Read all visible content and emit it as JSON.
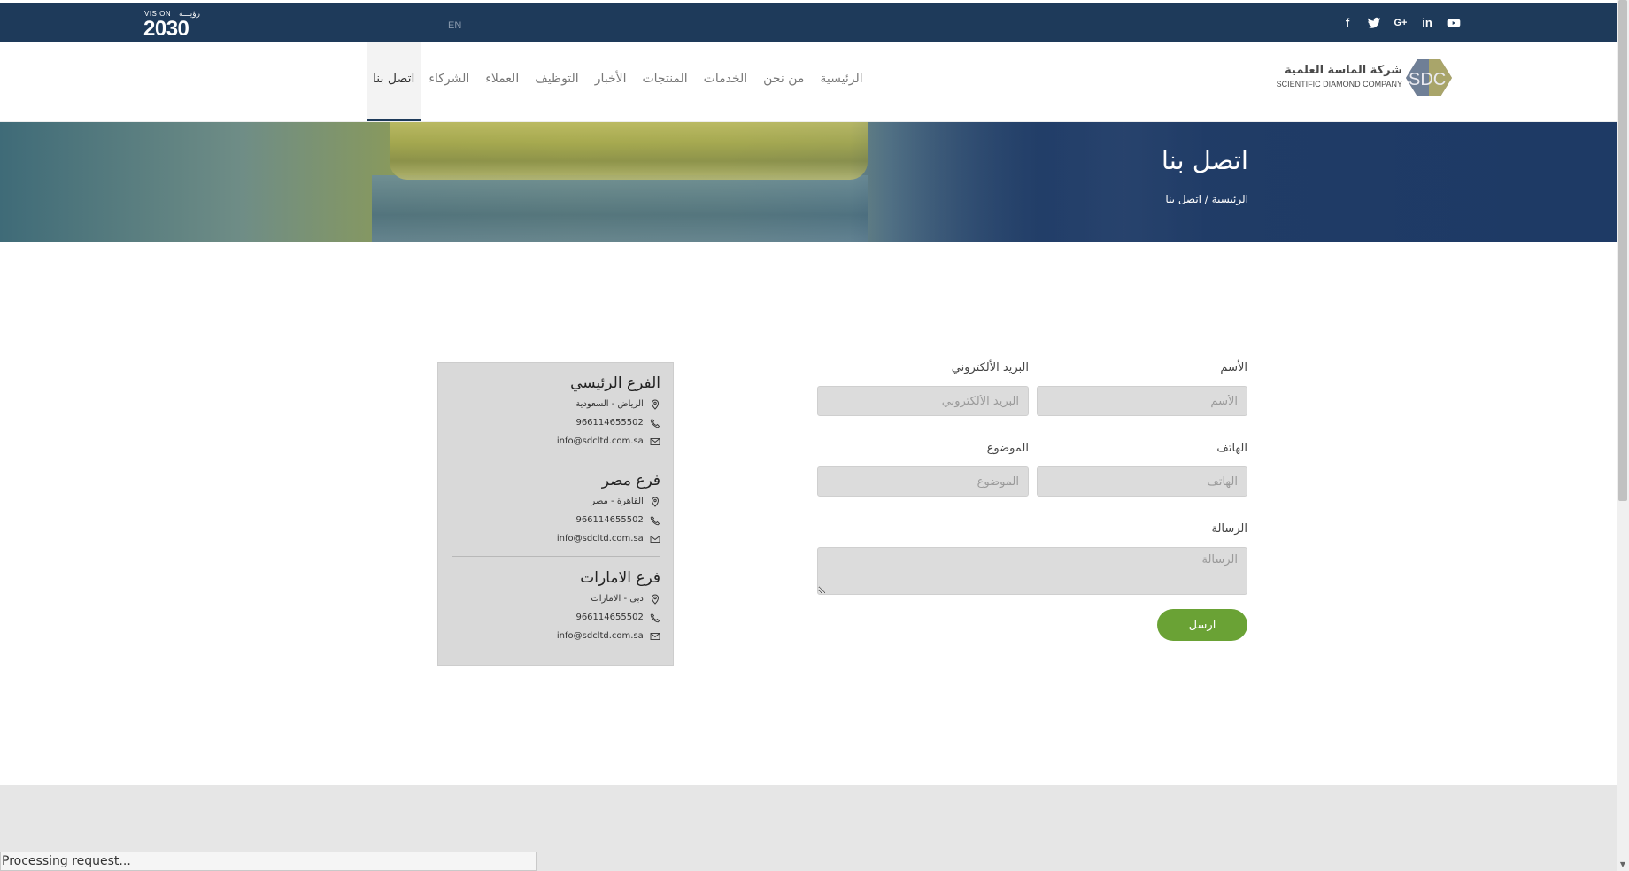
{
  "topbar": {
    "vision": {
      "small": "VISION",
      "arabic": "رؤيـــة",
      "year": "2030"
    },
    "lang_label": "EN",
    "social": [
      {
        "icon": "facebook-icon",
        "glyph": "f"
      },
      {
        "icon": "twitter-icon",
        "glyph": ""
      },
      {
        "icon": "google-plus-icon",
        "glyph": "G+"
      },
      {
        "icon": "linkedin-icon",
        "glyph": "in"
      },
      {
        "icon": "youtube-icon",
        "glyph": ""
      }
    ]
  },
  "header": {
    "logo_ar": "شركة الماسة العلمية",
    "logo_en": "SCIENTIFIC DIAMOND COMPANY",
    "logo_mark": "SDC",
    "nav": [
      "الرئيسية",
      "من نحن",
      "الخدمات",
      "المنتجات",
      "الأخبار",
      "التوظيف",
      "العملاء",
      "الشركاء",
      "اتصل بنا"
    ],
    "active_nav": "اتصل بنا"
  },
  "banner": {
    "title": "اتصل بنا",
    "breadcrumb": "الرئيسية / اتصل بنا"
  },
  "form": {
    "name_label": "الأسم",
    "name_placeholder": "الأسم",
    "email_label": "البريد الألكتروني",
    "email_placeholder": "البريد الألكتروني",
    "phone_label": "الهاتف",
    "phone_placeholder": "الهاتف",
    "subject_label": "الموضوع",
    "subject_placeholder": "الموضوع",
    "message_label": "الرسالة",
    "message_placeholder": "الرسالة",
    "send_label": "ارسل"
  },
  "branches": [
    {
      "title": "الفرع الرئيسي",
      "location": "الرياض - السعودية",
      "phone": "966114655502",
      "email": "info@sdcltd.com.sa"
    },
    {
      "title": "فرع مصر",
      "location": "القاهرة - مصر",
      "phone": "966114655502",
      "email": "info@sdcltd.com.sa"
    },
    {
      "title": "فرع الامارات",
      "location": "دبى - الامارات",
      "phone": "966114655502",
      "email": "info@sdcltd.com.sa"
    }
  ],
  "status_bar": "Processing request...",
  "colors": {
    "topbar": "#1e3a5a",
    "accent_green": "#6aa235",
    "banner_overlay": "#1e3a65"
  }
}
